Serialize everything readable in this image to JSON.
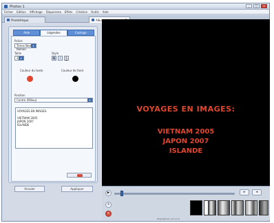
{
  "window": {
    "title": "Photos 1",
    "minimize": "_",
    "maximize": "□",
    "close": "x"
  },
  "menubar": [
    "Fichier",
    "Edition",
    "Affichage",
    "Diaporama",
    "Effets",
    "Création",
    "Outils",
    "Aide"
  ],
  "doc_tabs": [
    {
      "label": "Photothèque"
    },
    {
      "label": "Album diapos"
    }
  ],
  "panel": {
    "tabs": [
      "Aide",
      "Légendes",
      "Cadrage"
    ],
    "font_label": "Police",
    "font_value": "Times New Roman",
    "size_label": "Taille",
    "size_value": "24",
    "style_label": "Style",
    "style_buttons": [
      "G",
      "I",
      "S"
    ],
    "text_color_label": "Couleur du texte",
    "bg_color_label": "Couleur de fond",
    "text_color": "#e0452e",
    "bg_color": "#000000",
    "position_label": "Position",
    "position_value": "Centre (Milieu)",
    "caption_lines": [
      "VOYAGES EN IMAGES:",
      "",
      "VIETNAM 2005",
      "JAPON 2007",
      "ISLANDE"
    ],
    "cancel_label": "Annuler",
    "apply_label": "Appliquer"
  },
  "preview": {
    "title": "VOYAGES EN IMAGES:",
    "lines": [
      "VIETNAM 2005",
      "JAPON 2007",
      "ISLANDE"
    ]
  },
  "timeline": {
    "status": "Diapositives 1-8 sur 8",
    "play": "▶",
    "add": "+",
    "remove": "x",
    "progress": 0.06
  }
}
